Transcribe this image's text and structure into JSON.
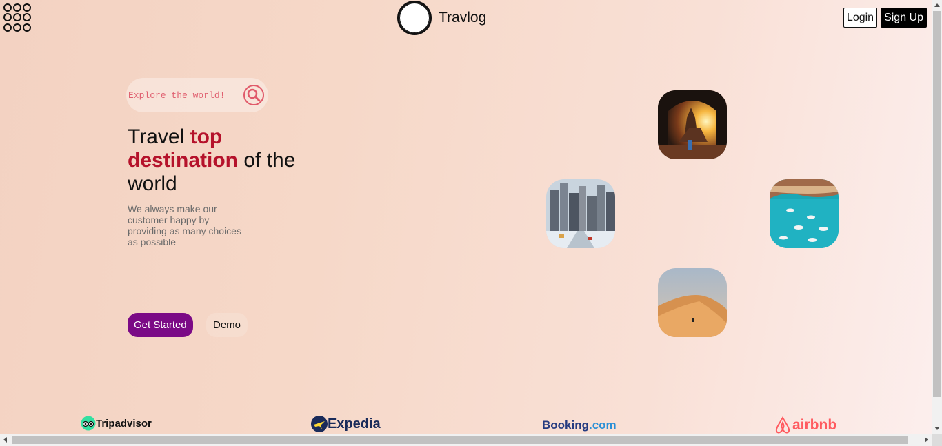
{
  "header": {
    "brand_name": "Travlog",
    "login_label": "Login",
    "signup_label": "Sign Up",
    "menu_icon": "grid-menu-icon",
    "logo_icon": "circle-logo-icon"
  },
  "hero": {
    "search_placeholder": "Explore the world!",
    "search_icon": "search-icon",
    "headline_part1": "Travel ",
    "headline_highlight": "top destination",
    "headline_part2": " of the world",
    "subtext": "We always make our customer happy by providing as many choices as possible",
    "get_started_label": "Get Started",
    "demo_label": "Demo",
    "accent_color": "#b5122b",
    "button_color": "#7b0a86"
  },
  "destinations": [
    {
      "name": "temple-sunset-image"
    },
    {
      "name": "snowy-city-image"
    },
    {
      "name": "coastal-bay-image"
    },
    {
      "name": "desert-dune-image"
    }
  ],
  "partners": {
    "tripadvisor": "Tripadvisor",
    "expedia": "Expedia",
    "booking": "Booking",
    "booking_suffix": ".com",
    "airbnb": "airbnb"
  }
}
